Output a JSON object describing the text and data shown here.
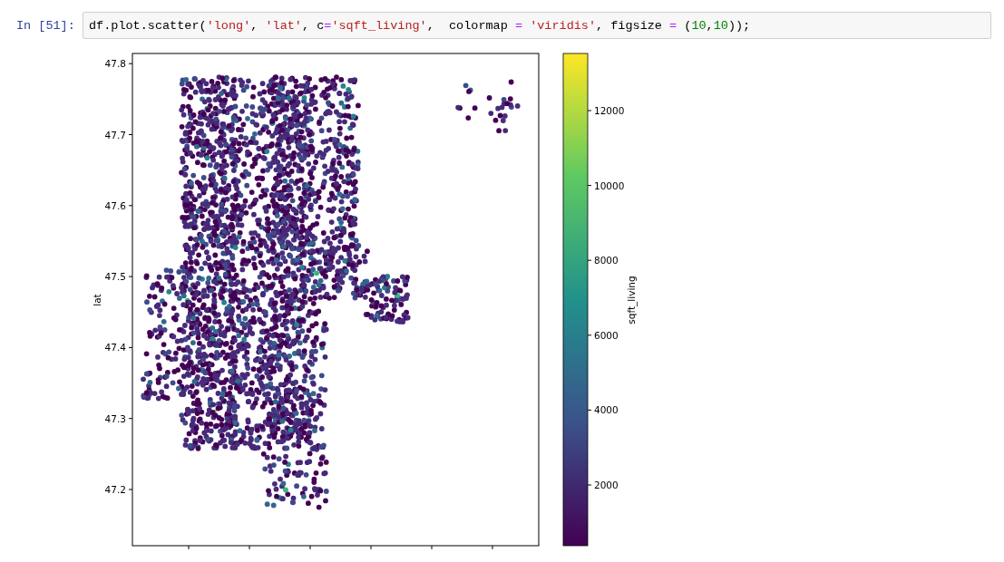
{
  "cell": {
    "prompt": "In [51]:",
    "code": [
      {
        "kind": "plain",
        "text": "df.plot.scatter("
      },
      {
        "kind": "string",
        "text": "'long'"
      },
      {
        "kind": "plain",
        "text": ", "
      },
      {
        "kind": "string",
        "text": "'lat'"
      },
      {
        "kind": "plain",
        "text": ", c"
      },
      {
        "kind": "operator",
        "text": "="
      },
      {
        "kind": "string",
        "text": "'sqft_living'"
      },
      {
        "kind": "plain",
        "text": ",  colormap "
      },
      {
        "kind": "operator",
        "text": "= "
      },
      {
        "kind": "string",
        "text": "'viridis'"
      },
      {
        "kind": "plain",
        "text": ", figsize "
      },
      {
        "kind": "operator",
        "text": "="
      },
      {
        "kind": "plain",
        "text": " ("
      },
      {
        "kind": "number",
        "text": "10"
      },
      {
        "kind": "plain",
        "text": ","
      },
      {
        "kind": "number",
        "text": "10"
      },
      {
        "kind": "plain",
        "text": "));"
      }
    ]
  },
  "plot": {
    "ylabel": "lat",
    "yticks": [
      "47.8",
      "47.7",
      "47.6",
      "47.5",
      "47.4",
      "47.3",
      "47.2"
    ],
    "colorbar": {
      "label": "sqft_living",
      "ticks": [
        "12000",
        "10000",
        "8000",
        "6000",
        "4000",
        "2000"
      ]
    }
  }
}
